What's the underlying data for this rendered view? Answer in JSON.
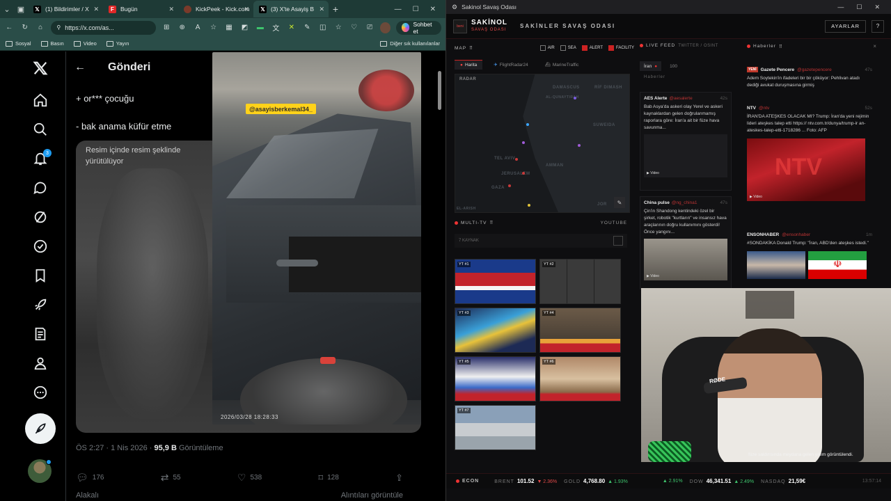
{
  "browser": {
    "tabs": [
      {
        "label": "(1) Bildirimler / X",
        "icon": "x-logo",
        "fav_color": "#000000"
      },
      {
        "label": "Bugün",
        "icon": "flipboard-logo",
        "fav_color": "#e12828"
      },
      {
        "label": "KickPeek - Kick.com",
        "icon": "kickpeek-logo",
        "fav_color": "#7a3a2a"
      },
      {
        "label": "(3) X'te Asayiş B",
        "icon": "x-logo",
        "fav_color": "#000000"
      }
    ],
    "url": "https://x.com/as...",
    "chat_label": "Sohbet et",
    "bookmarks": [
      {
        "label": "Sosyal"
      },
      {
        "label": "Basın"
      },
      {
        "label": "Video"
      },
      {
        "label": "Yayın"
      }
    ],
    "bookmarks_other": "Diğer sık kullanılanlar"
  },
  "x": {
    "header_title": "Gönderi",
    "notification_count": "3",
    "tweet_lines": [
      "+ or*** çocuğu",
      "- bak anama küfür etme"
    ],
    "pip_text": "Resim içinde resim şeklinde yürütülüyor",
    "meta_time": "ÖS 2:27 · 1 Nis 2026 · ",
    "meta_views": "95,9 B",
    "meta_views_label": " Görüntüleme",
    "actions": {
      "replies": "176",
      "reposts": "55",
      "likes": "538",
      "bookmarks": "128"
    },
    "bottom_left": "Alakalı",
    "bottom_right": "Alıntıları görüntüle"
  },
  "video": {
    "watermark": "@asayisberkemal34_",
    "timestamp": "2026/03/28  18:28:33"
  },
  "war": {
    "window_title": "Sakinol Savaş Odası",
    "brand_top": "SAKİNOL",
    "brand_bottom": "SAVAŞ ODASI",
    "title": "SAKİNLER SAVAŞ ODASI",
    "settings_label": "AYARLAR",
    "help_label": "?",
    "map": {
      "label": "MAP",
      "toggles": [
        {
          "label": "AIR",
          "on": false
        },
        {
          "label": "SEA",
          "on": false
        },
        {
          "label": "ALERT",
          "on": true
        },
        {
          "label": "FACILITY",
          "on": true
        }
      ],
      "tabs": [
        "Harita",
        "FlightRadar24",
        "MarineTraffic"
      ],
      "radar": "RADAR",
      "cities": [
        "DAMASCUS",
        "RİF DIMASH",
        "AL-QUNAYTIRAH",
        "SUWEIDA",
        "TEL AVIV",
        "JERUSALEM",
        "AMMAN",
        "GAZA",
        "JOR",
        "EL-ARISH"
      ]
    },
    "multitv": {
      "label": "MULTI-TV",
      "source": "YOUTUBE",
      "sub": "7 KAYNAK",
      "thumbs": [
        "YT #1",
        "YT #2",
        "YT #3",
        "YT #4",
        "YT #5",
        "YT #6",
        "YT #7"
      ]
    },
    "feed": {
      "label": "LIVE FEED",
      "sub": "TWITTER / OSINT",
      "tabs": [
        "İran",
        "100"
      ],
      "section": "Haberler",
      "cards": [
        {
          "name": "AES Alerte",
          "handle": "@aesalerte",
          "time": "42s",
          "text": "Bab Asya'da askeri olay Yerel ve askeri kaynaklardan gelen doğrulanmamış raporlara göre: İran'a ait bir füze hava savunma...",
          "video": "Video"
        },
        {
          "name": "China pulse",
          "handle": "@ng_china1",
          "time": "47s",
          "text": "Çin'in Shandong kentindeki özel bir şirket, robotik \"kurtların\" ve insansız hava araçlarının doğru kullanımını gösterdi! Önce yangını...",
          "video": "Video"
        }
      ]
    },
    "news": {
      "label": "Haberler",
      "close": "×",
      "items": [
        {
          "badge": "YENİ",
          "name": "Gazete Pencere",
          "handle": "@gazetepencere",
          "time": "47s",
          "text": "Adem Soytekin'in ifadeleri bir bir çöküyor: Pehlivan atadı dediği avukat duruşmasına girmiş"
        },
        {
          "name": "NTV",
          "handle": "@ntv",
          "time": "52s",
          "text": "İRAN'DA ATEŞKES OLACAK MI? Trump: İran'da yeni rejimin lideri ateşkes talep etti https:// ntv.com.tr/dunya/trump-ir an-ateskes-talep-etti-1718286 ... Foto: AFP",
          "video": "Video"
        },
        {
          "name": "ENSONHABER",
          "handle": "@ensonhaber",
          "time": "1m",
          "text": "#SONDAKİKA Donald Trump: \"İran, ABD'den ateşkes istedi.\""
        }
      ]
    },
    "cam": {
      "mic_brand": "RØDE",
      "caption": "füze saldırısında meydana gelen yıkım görüntülendi."
    },
    "econ": {
      "label": "ECON",
      "items": [
        {
          "name": "BRENT",
          "value": "101.52",
          "change": "▼ 2.36%",
          "dir": "down"
        },
        {
          "name": "GOLD",
          "value": "4,768.80",
          "change": "▲ 1.93%",
          "dir": "up"
        },
        {
          "name": "",
          "value": "",
          "change": "▲ 2.91%",
          "dir": "up"
        },
        {
          "name": "DOW",
          "value": "46,341.51",
          "change": "▲ 2.49%",
          "dir": "up"
        },
        {
          "name": "NASDAQ",
          "value": "21,59€",
          "change": "",
          "dir": "up"
        }
      ],
      "clock": "13:57:14"
    }
  },
  "colors": {
    "accent": "#c22222",
    "x_blue": "#1d9bf0",
    "tab_green": "#2a4d48"
  }
}
